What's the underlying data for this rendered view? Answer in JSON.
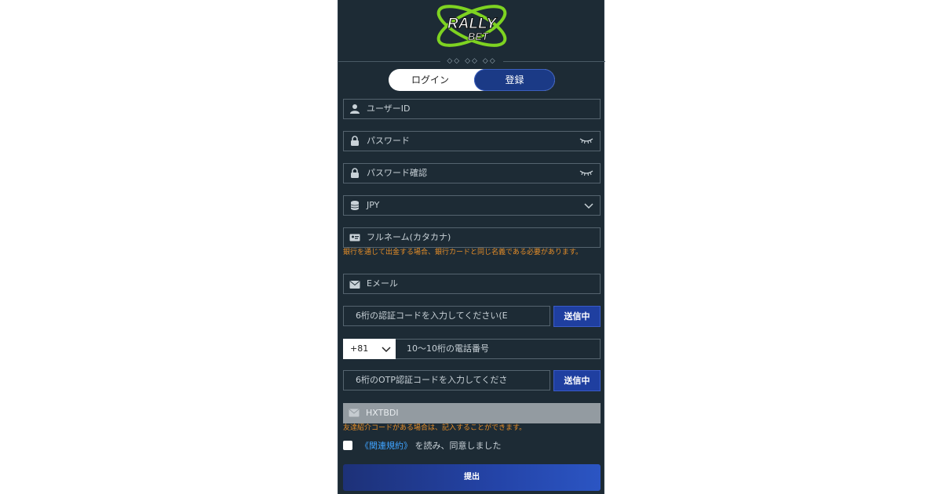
{
  "brand": {
    "logo_line1": "RALLY",
    "logo_line2": "BET"
  },
  "auth_tabs": {
    "login": "ログイン",
    "register": "登録"
  },
  "form": {
    "user_id": "ユーザーID",
    "password": "パスワード",
    "password_confirm": "パスワード確認",
    "currency": "JPY",
    "full_name": "フルネーム(カタカナ)",
    "full_name_hint": "銀行を通じて出金する場合、銀行カードと同じ名義である必要があります。",
    "email": "Eメール",
    "email_code_placeholder": "6桁の認証コードを入力してください(E",
    "email_send_button": "送信中",
    "country_code": "+81",
    "phone_placeholder": "10～10桁の電話番号",
    "otp_placeholder": "6桁のOTP認証コードを入力してくださ",
    "otp_send_button": "送信中",
    "referral_code": "HXTBDI",
    "referral_hint": "友達紹介コードがある場合は、記入することができます。",
    "terms_link": "《関連規約》",
    "terms_text": "を読み、同意しました",
    "submit": "提出"
  },
  "colors": {
    "panel_bg": "#1d2b35",
    "accent_blue": "#1f3fa0",
    "hint_orange": "#e58d28",
    "link_blue": "#3fa3ff",
    "logo_green": "#7ed321"
  },
  "icons": [
    "user-icon",
    "lock-icon",
    "eye-closed-icon",
    "database-icon",
    "chevron-down-icon",
    "id-card-icon",
    "envelope-icon"
  ]
}
